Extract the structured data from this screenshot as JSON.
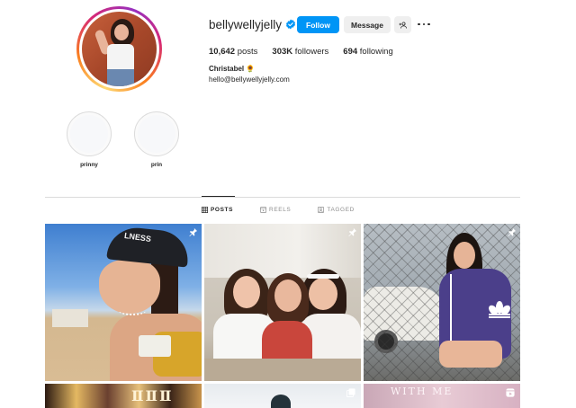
{
  "profile": {
    "username": "bellywellyjelly",
    "verified": true,
    "follow_label": "Follow",
    "message_label": "Message",
    "stats": {
      "posts_count": "10,642",
      "posts_label": "posts",
      "followers_count": "303K",
      "followers_label": "followers",
      "following_count": "694",
      "following_label": "following"
    },
    "full_name": "Christabel 🌻",
    "email": "hello@bellywellyjelly.com"
  },
  "highlights": [
    {
      "label": "prinny"
    },
    {
      "label": "prin"
    }
  ],
  "tabs": [
    {
      "label": "POSTS",
      "icon": "grid-icon",
      "active": true
    },
    {
      "label": "REELS",
      "icon": "reels-icon",
      "active": false
    },
    {
      "label": "TAGGED",
      "icon": "tagged-icon",
      "active": false
    }
  ],
  "posts": [
    {
      "pinned": true,
      "cap_text": "LNESS"
    },
    {
      "pinned": true
    },
    {
      "pinned": true
    },
    {
      "pinned": false,
      "sign_text": "ⅡⅡⅡ"
    },
    {
      "pinned": false,
      "multi": true
    },
    {
      "pinned": false,
      "overlay_text": "WITH ME",
      "reel": true
    }
  ],
  "colors": {
    "accent": "#0095f6",
    "secondary_button": "#efefef",
    "divider": "#dbdbdb",
    "muted_text": "#8e8e8e"
  }
}
